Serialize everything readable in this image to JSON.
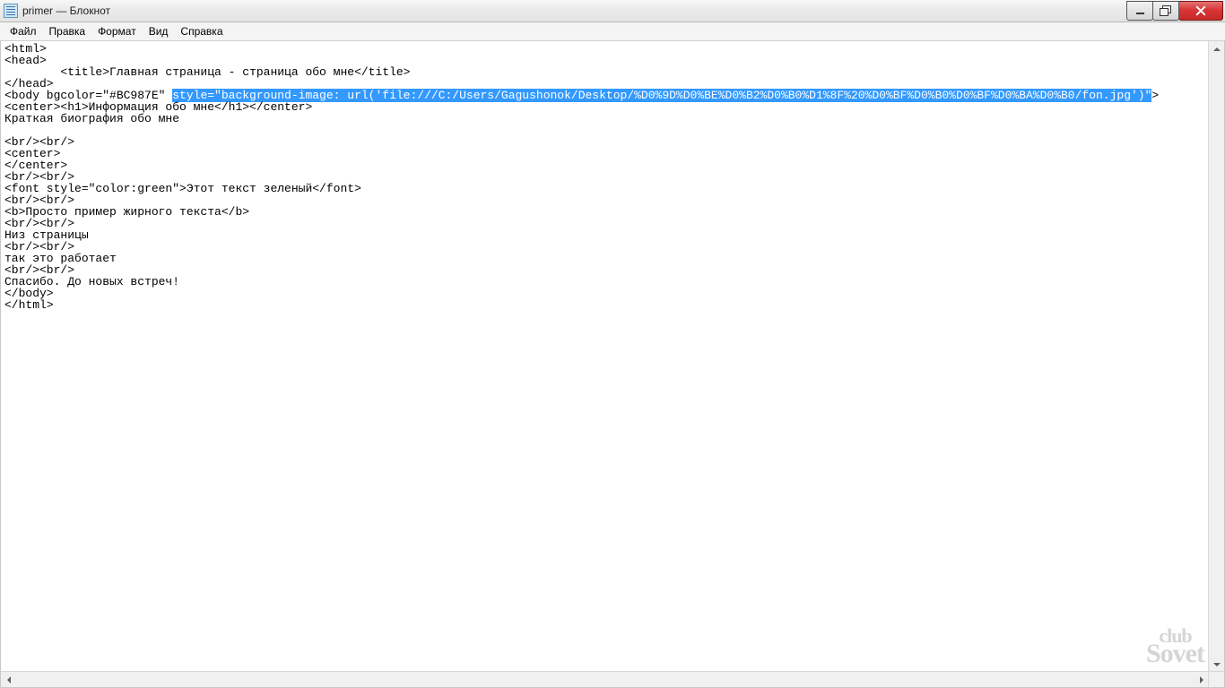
{
  "titlebar": {
    "title": "primer — Блокнот"
  },
  "menu": {
    "file": "Файл",
    "edit": "Правка",
    "format": "Формат",
    "view": "Вид",
    "help": "Справка"
  },
  "editor": {
    "l01": "<html>",
    "l02": "<head>",
    "l03": "        <title>Главная страница - страница обо мне</title>",
    "l04": "</head>",
    "l05_a": "<body bgcolor=\"#BC987E\" ",
    "l05_sel": "style=\"background-image: url('file:///C:/Users/Gagushonok/Desktop/%D0%9D%D0%BE%D0%B2%D0%B0%D1%8F%20%D0%BF%D0%B0%D0%BF%D0%BA%D0%B0/fon.jpg')\"",
    "l05_b": ">",
    "l06": "<center><h1>Информация обо мне</h1></center>",
    "l07": "Краткая биография обо мне",
    "l08": "",
    "l09": "<br/><br/>",
    "l10": "<center>",
    "l11": "</center>",
    "l12": "<br/><br/>",
    "l13": "<font style=\"color:green\">Этот текст зеленый</font>",
    "l14": "<br/><br/>",
    "l15": "<b>Просто пример жирного текста</b>",
    "l16": "<br/><br/>",
    "l17": "Низ страницы",
    "l18": "<br/><br/>",
    "l19": "так это работает",
    "l20": "<br/><br/>",
    "l21": "Спасибо. До новых встреч!",
    "l22": "</body>",
    "l23": "</html>"
  },
  "watermark": {
    "line1": "club",
    "line2": "Sovet"
  }
}
